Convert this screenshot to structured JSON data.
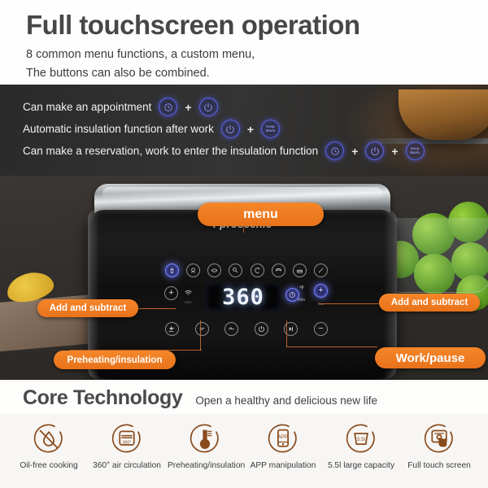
{
  "header": {
    "title": "Full touchscreen operation",
    "subtitle_line1": "8 common menu functions, a custom menu,",
    "subtitle_line2": "The buttons can also be combined."
  },
  "combinations": {
    "plus_symbol": "+",
    "rows": [
      {
        "text": "Can make an appointment",
        "icons": [
          "timer-icon",
          "power-icon"
        ]
      },
      {
        "text": "Automatic insulation function after work",
        "icons": [
          "power-icon",
          "keep-warm-icon"
        ]
      },
      {
        "text": "Can make a reservation, work to enter the insulation function",
        "icons": [
          "timer-icon",
          "power-icon",
          "keep-warm-icon"
        ]
      }
    ],
    "keep_warm_label_line1": "Keep",
    "keep_warm_label_line2": "Warm"
  },
  "product": {
    "brand": "proscenic",
    "brand_mark": "P",
    "display_value": "360",
    "display_unit_temp": "℉",
    "display_unit_time": "Min",
    "wifi_label": "WIFI",
    "timer_micro_label": "Time",
    "menu_icons": [
      "fries-icon",
      "chicken-icon",
      "fish-icon",
      "drumstick-icon",
      "shrimp-icon",
      "bacon-icon",
      "cake-icon",
      "custom-icon"
    ],
    "bottom_buttons": [
      "minus-icon",
      "preheat-icon",
      "keep-warm-icon",
      "power-icon",
      "play-pause-icon",
      "minus-icon"
    ],
    "callouts": [
      {
        "label": "menu",
        "name": "callout-menu"
      },
      {
        "label": "Add and subtract",
        "name": "callout-add-subtract-left"
      },
      {
        "label": "Add and subtract",
        "name": "callout-add-subtract-right"
      },
      {
        "label": "Preheating/insulation",
        "name": "callout-preheating-insulation"
      },
      {
        "label": "Work/pause",
        "name": "callout-work-pause"
      }
    ]
  },
  "core": {
    "title": "Core Technology",
    "tagline": "Open a healthy and delicious new life",
    "features": [
      {
        "caption": "Oil-free cooking",
        "icon": "no-oil-icon"
      },
      {
        "caption": "360° air circulation",
        "icon": "air-circulation-icon",
        "badge": "360°"
      },
      {
        "caption": "Preheating/insulation",
        "icon": "thermometer-icon"
      },
      {
        "caption": "APP manipulation",
        "icon": "app-phone-icon",
        "badge": "APP"
      },
      {
        "caption": "5.5l large capacity",
        "icon": "basket-icon",
        "badge": "5.5l"
      },
      {
        "caption": "Full touch screen",
        "icon": "touch-hand-icon"
      }
    ]
  },
  "colors": {
    "accent_orange": "#ee7a1f",
    "glow_blue": "#5a63e0",
    "icon_brown": "#8a4b1d",
    "dark_bg": "#2e2c2a",
    "heading_gray": "#474747"
  }
}
